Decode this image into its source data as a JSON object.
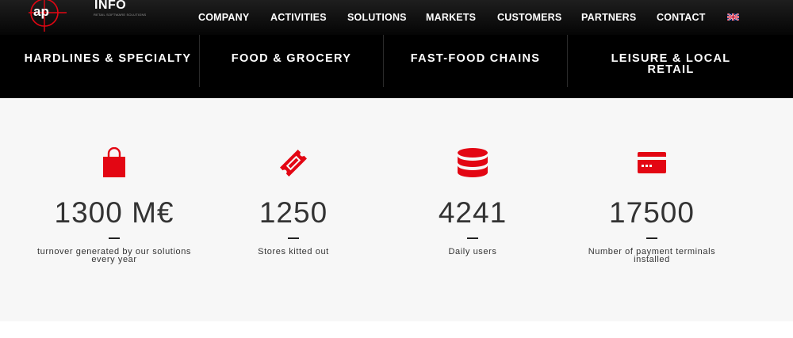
{
  "brand": {
    "name": "INFO",
    "mark": "ap",
    "tagline": "RETAIL SOFTWARE SOLUTIONS"
  },
  "nav": {
    "items": [
      "COMPANY",
      "ACTIVITIES",
      "SOLUTIONS",
      "MARKETS",
      "CUSTOMERS",
      "PARTNERS",
      "CONTACT"
    ],
    "language_icon": "uk-flag-icon"
  },
  "subnav": {
    "items": [
      "HARDLINES & SPECIALTY",
      "FOOD & GROCERY",
      "FAST-FOOD CHAINS",
      "LEISURE & LOCAL RETAIL"
    ]
  },
  "stats": [
    {
      "icon": "shopping-bag-icon",
      "value": "1300 M€",
      "label": "turnover generated by our solutions every year"
    },
    {
      "icon": "ticket-icon",
      "value": "1250",
      "label": "Stores kitted out"
    },
    {
      "icon": "database-icon",
      "value": "4241",
      "label": "Daily users"
    },
    {
      "icon": "credit-card-icon",
      "value": "17500",
      "label": "Number of payment terminals installed"
    }
  ],
  "colors": {
    "accent": "#e30613",
    "header_bg": "#000000",
    "stats_bg": "#f7f7f7",
    "text": "#333333"
  }
}
